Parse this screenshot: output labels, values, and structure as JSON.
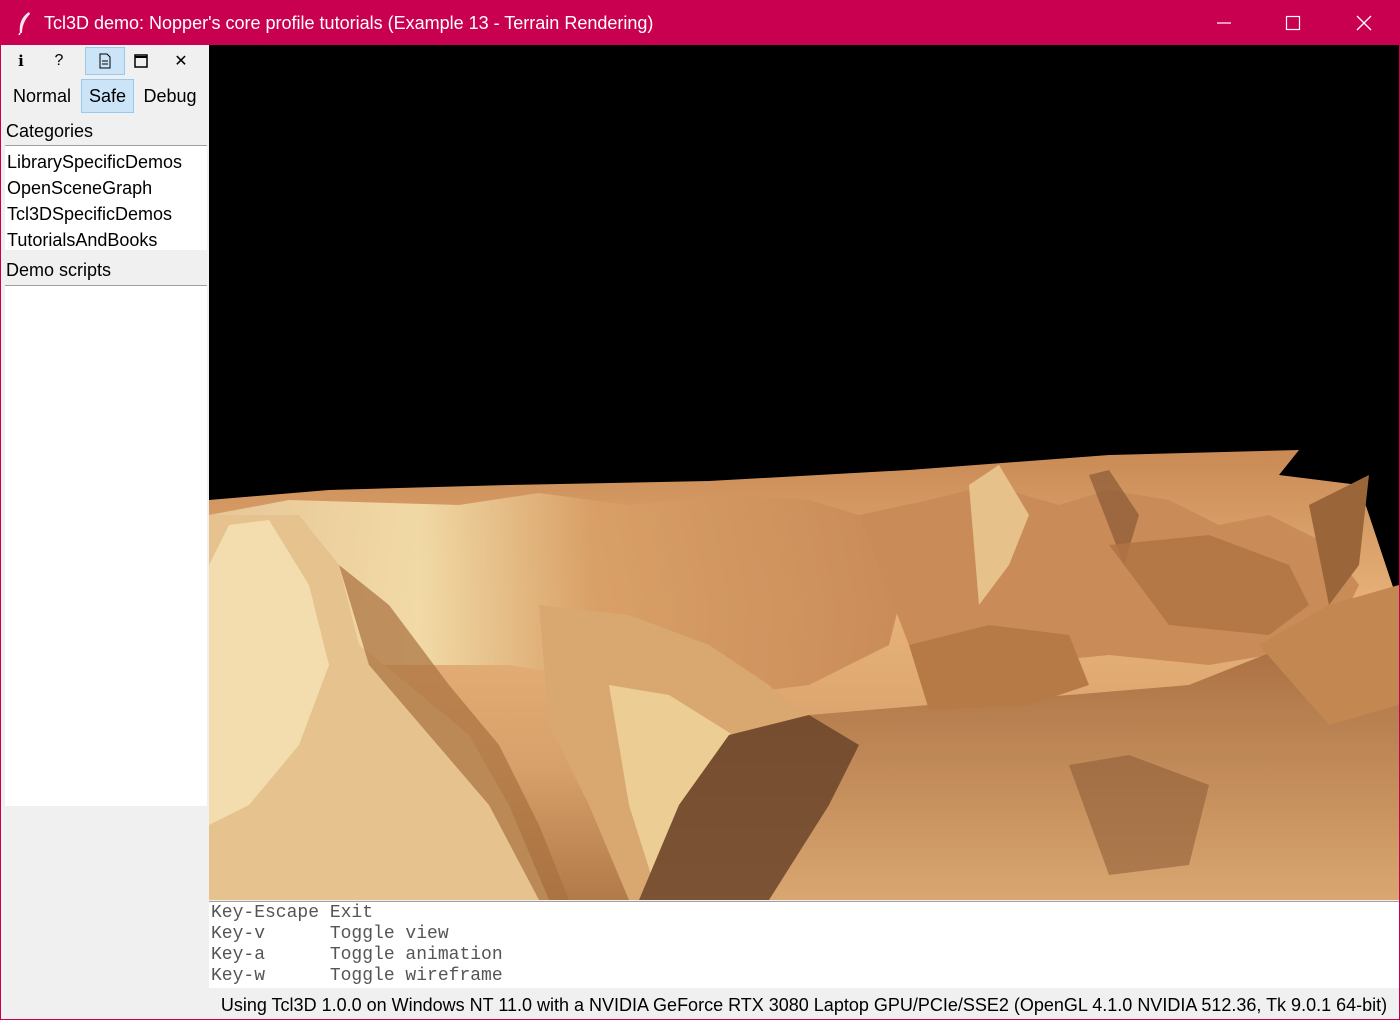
{
  "window": {
    "title": "Tcl3D demo: Nopper's core profile tutorials (Example 13 - Terrain Rendering)",
    "accent_color": "#c8004f"
  },
  "toolbar": {
    "icons": [
      "info-icon",
      "help-icon",
      "document-icon",
      "fullscreen-icon",
      "close-icon"
    ],
    "info_glyph": "i",
    "help_glyph": "?",
    "close_glyph": "✕"
  },
  "modes": [
    {
      "label": "Normal",
      "active": false
    },
    {
      "label": "Safe",
      "active": true
    },
    {
      "label": "Debug",
      "active": false
    }
  ],
  "categories": {
    "label": "Categories",
    "items": [
      "LibrarySpecificDemos",
      "OpenSceneGraph",
      "Tcl3DSpecificDemos",
      "TutorialsAndBooks"
    ]
  },
  "demo_scripts": {
    "label": "Demo scripts",
    "items": []
  },
  "help": {
    "lines": [
      "Key-Escape Exit",
      "Key-v      Toggle view",
      "Key-a      Toggle animation",
      "Key-w      Toggle wireframe"
    ]
  },
  "status": {
    "text": "Using Tcl3D 1.0.0 on Windows NT 11.0 with a NVIDIA GeForce RTX 3080 Laptop GPU/PCIe/SSE2 (OpenGL 4.1.0 NVIDIA 512.36, Tk 9.0.1 64-bit)"
  }
}
